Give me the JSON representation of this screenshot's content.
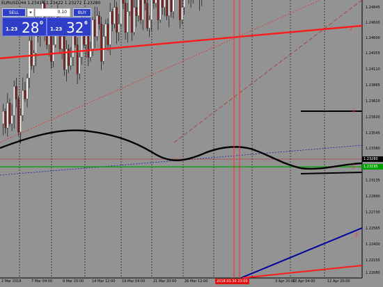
{
  "chart": {
    "title": "EURUSD,H4  1.23414 1.23422 1.23272 1.23280"
  },
  "trade_panel": {
    "sell_label": "SELL",
    "buy_label": "BUY",
    "lot_value": "0.10",
    "sell_price_prefix": "1.23",
    "sell_price_big": "28",
    "sell_price_sup": "0",
    "buy_price_prefix": "1.23",
    "buy_price_big": "32",
    "buy_price_sup": "6"
  },
  "price_axis": {
    "labels": [
      "1.24845",
      "1.24600",
      "1.24355",
      "1.24110",
      "1.23865",
      "1.23620",
      "1.23380",
      "1.23135",
      "1.22890",
      "1.22645",
      "1.22400",
      "1.22155"
    ],
    "extra_labels": [
      "1.23545",
      "1.22730",
      "1.22565",
      "1.22080"
    ],
    "current_bid": "1.23280",
    "green_level": "1.23195"
  },
  "time_axis": {
    "labels": [
      "2 Mar 2018",
      "7 Mar 04:00",
      "9 Mar 20:00",
      "14 Mar 12:00",
      "19 Mar 04:00",
      "21 Mar 20:00",
      "26 Mar 12:00",
      "3 Apr 20:00",
      "10 Apr 04:00",
      "12 Apr 20:00"
    ],
    "highlight": "2018.03.30 23:00"
  },
  "colors": {
    "background": "#939393",
    "bull_candle": "#ffffff",
    "bear_candle": "#8b1a1a",
    "panel_blue": "#2f3ec6",
    "trendline_red": "#ff1a1a",
    "trendline_blue": "#0000a0",
    "ma_line": "#000000",
    "horizontal_green": "#00a000"
  },
  "chart_data": {
    "type": "candlestick",
    "symbol": "EURUSD",
    "timeframe": "H4",
    "ylim": [
      1.2195,
      1.2496
    ],
    "y": {
      "start": 1.2362,
      "moves": [
        3,
        -4,
        6,
        -5,
        2,
        7,
        -3,
        -8,
        4,
        6,
        -2,
        5,
        9,
        -6,
        3,
        8,
        -4,
        2,
        6,
        -7,
        -3,
        5,
        -9,
        4,
        7,
        -2,
        -6,
        3,
        -8,
        5,
        -4,
        2,
        6,
        -3,
        -7,
        4,
        8,
        -5,
        3,
        -6,
        2,
        7,
        -4,
        5,
        -2,
        -9,
        6,
        3,
        -5,
        8,
        -3,
        4,
        -6,
        2,
        9,
        -4,
        -7,
        5,
        3,
        -8,
        6,
        -2,
        4,
        -5,
        7,
        -3,
        -6,
        2,
        8,
        -4,
        3,
        -7,
        5,
        -2,
        6,
        -8,
        4,
        -3,
        7,
        2,
        -5,
        -6,
        3,
        8,
        -4,
        5,
        -7,
        2,
        6,
        -3,
        -5,
        4,
        9,
        -6,
        3,
        -2,
        7,
        -8,
        5,
        -4,
        2,
        6,
        -7,
        3,
        -5,
        8,
        -2,
        4,
        -6,
        3,
        7,
        -9,
        5,
        -3,
        2,
        -6,
        8,
        -4,
        6,
        -2,
        -5,
        7,
        3,
        -8,
        4,
        -3,
        5,
        -6,
        2,
        9,
        -7,
        4,
        -2,
        6,
        -5,
        3,
        -8,
        7,
        -3,
        2,
        5,
        -6,
        4,
        -7,
        8,
        -2,
        3,
        -5,
        6,
        -4,
        2,
        7,
        -9,
        5,
        -3,
        4,
        -6,
        8,
        -2,
        3,
        -7,
        5,
        -4,
        6
      ],
      "step": 0.00045
    }
  }
}
